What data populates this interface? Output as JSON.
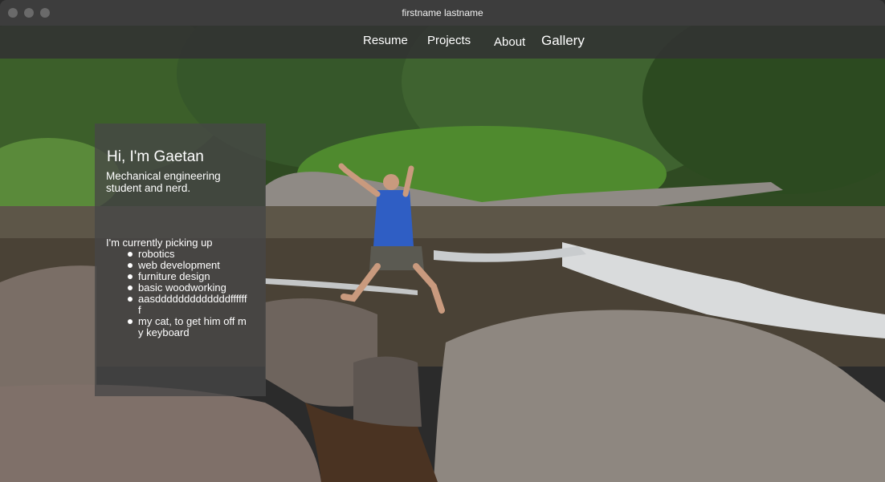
{
  "window": {
    "title": "firstname lastname"
  },
  "nav": {
    "links": [
      {
        "label": "Resume"
      },
      {
        "label": "Projects"
      },
      {
        "label": "About"
      },
      {
        "label": "Gallery"
      }
    ]
  },
  "intro_card": {
    "heading": "Hi, I'm Gaetan",
    "subtitle": "Mechanical engineering student and nerd.",
    "picking_up_label": "I'm currently picking up",
    "items": [
      "robotics",
      "web development",
      "furniture design",
      "basic woodworking",
      "aasdddddddddddddfffffff",
      "my cat, to get him off my keyboard"
    ]
  },
  "colors": {
    "titlebar": "#3d3d3d",
    "navbar": "#323232",
    "card": "#464646",
    "text": "#ffffff"
  },
  "icons": [
    "window-close-dot",
    "window-minimize-dot",
    "window-maximize-dot"
  ]
}
